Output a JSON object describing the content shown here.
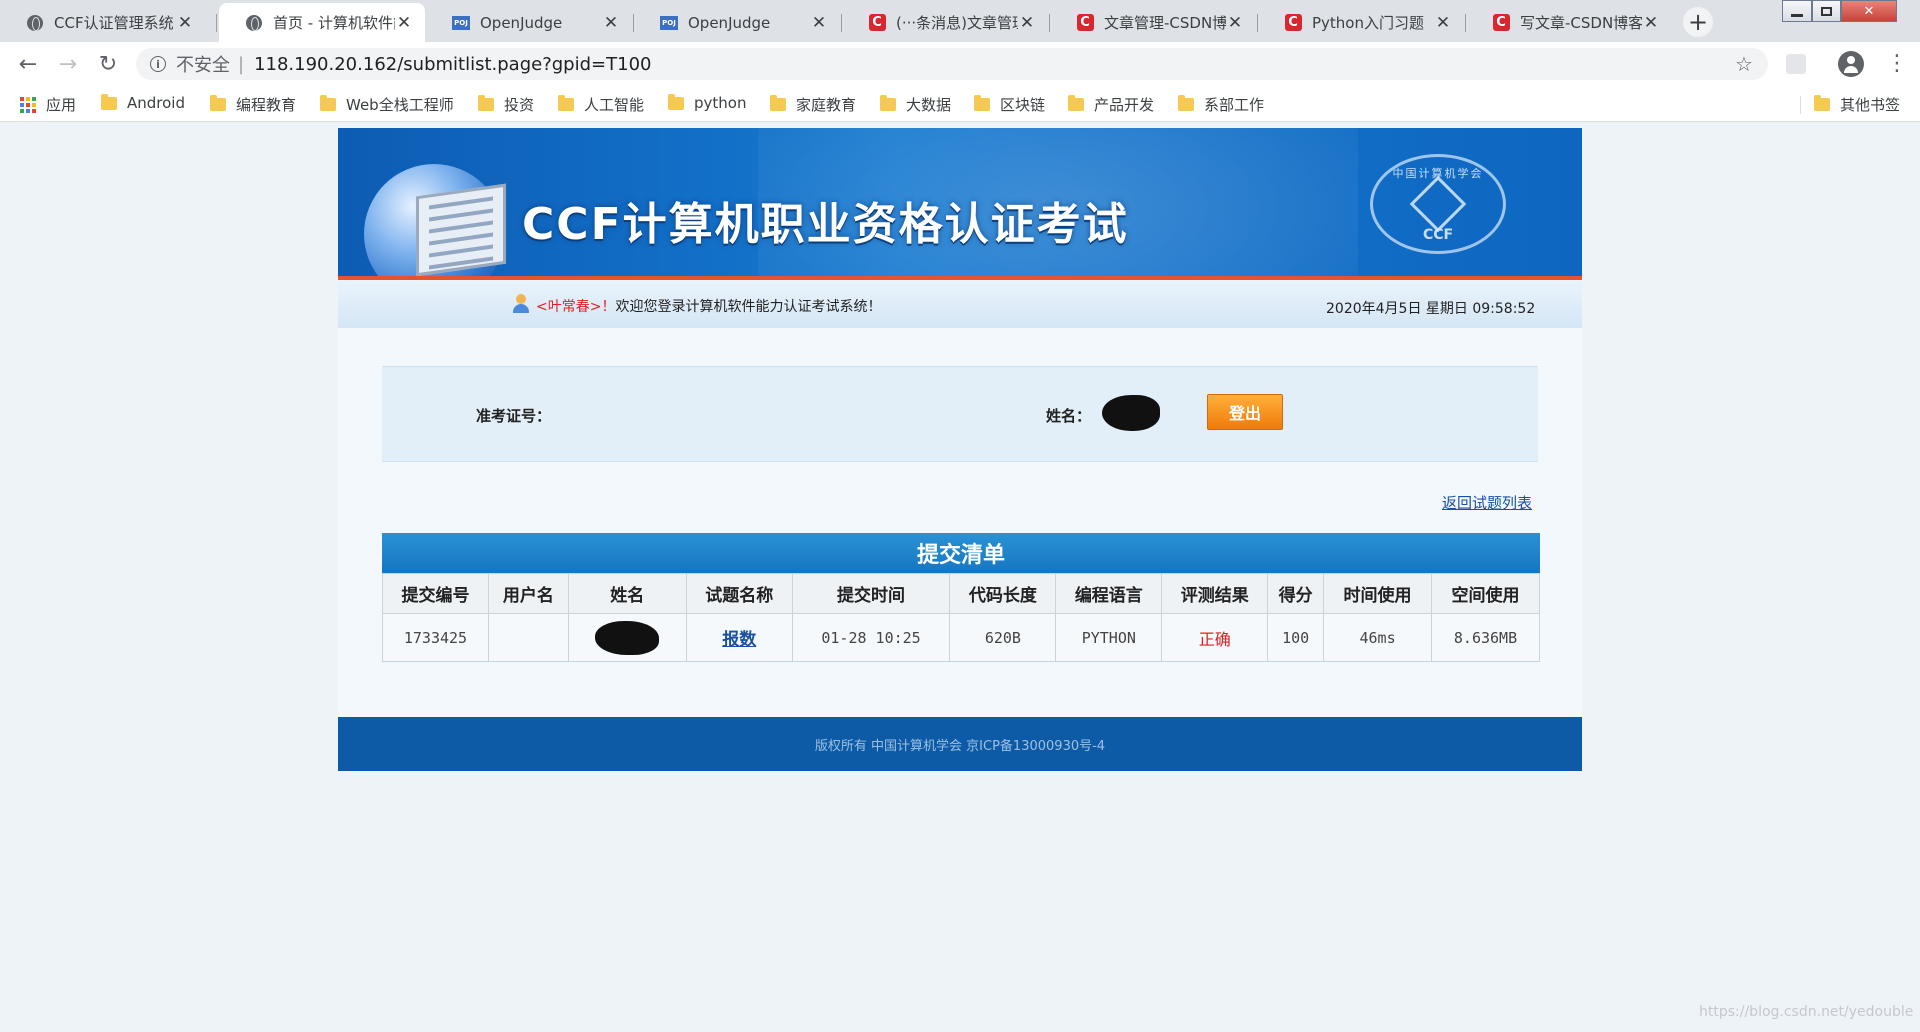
{
  "browser": {
    "tabs": [
      {
        "title": "CCF认证管理系统",
        "icon": "globe-icon",
        "active": false
      },
      {
        "title": "首页 - 计算机软件能",
        "icon": "globe-icon",
        "active": true
      },
      {
        "title": "OpenJudge",
        "icon": "poj-icon",
        "active": false
      },
      {
        "title": "OpenJudge",
        "icon": "poj-icon",
        "active": false
      },
      {
        "title": "(···条消息)文章管理",
        "icon": "csdn-icon",
        "active": false
      },
      {
        "title": "文章管理-CSDN博",
        "icon": "csdn-icon",
        "active": false
      },
      {
        "title": "Python入门习题（",
        "icon": "csdn-icon",
        "active": false
      },
      {
        "title": "写文章-CSDN博客",
        "icon": "csdn-icon",
        "active": false
      }
    ],
    "poj_icon_text": "POJ",
    "csdn_icon_text": "C",
    "new_tab": "+",
    "close_glyph": "✕",
    "back": "←",
    "forward": "→",
    "reload": "↻",
    "security_label": "不安全",
    "url": "118.190.20.162/submitlist.page?gpid=T100",
    "star": "☆",
    "menu": "⋮",
    "bookmarks": [
      {
        "label": "应用",
        "type": "apps"
      },
      {
        "label": "Android",
        "type": "folder"
      },
      {
        "label": "编程教育",
        "type": "folder"
      },
      {
        "label": "Web全栈工程师",
        "type": "folder"
      },
      {
        "label": "投资",
        "type": "folder"
      },
      {
        "label": "人工智能",
        "type": "folder"
      },
      {
        "label": "python",
        "type": "folder"
      },
      {
        "label": "家庭教育",
        "type": "folder"
      },
      {
        "label": "大数据",
        "type": "folder"
      },
      {
        "label": "区块链",
        "type": "folder"
      },
      {
        "label": "产品开发",
        "type": "folder"
      },
      {
        "label": "系部工作",
        "type": "folder"
      }
    ],
    "other_bookmarks": "其他书签"
  },
  "banner": {
    "title": "CCF计算机职业资格认证考试",
    "emblem_text": "中国计算机学会",
    "emblem_abbr": "CCF"
  },
  "welcome": {
    "username": "<叶常春>！",
    "message": "欢迎您登录计算机软件能力认证考试系统！",
    "datetime": "2020年4月5日 星期日 09:58:52"
  },
  "info": {
    "ticket_label": "准考证号：",
    "ticket_value": "",
    "name_label": "姓名：",
    "logout_label": "登出"
  },
  "back_link": "返回试题列表",
  "submissions": {
    "title": "提交清单",
    "headers": [
      "提交编号",
      "用户名",
      "姓名",
      "试题名称",
      "提交时间",
      "代码长度",
      "编程语言",
      "评测结果",
      "得分",
      "时间使用",
      "空间使用"
    ],
    "rows": [
      {
        "id": "1733425",
        "username": "",
        "problem": "报数",
        "time": "01-28 10:25",
        "length": "620B",
        "language": "PYTHON",
        "result": "正确",
        "score": "100",
        "time_used": "46ms",
        "memory_used": "8.636MB"
      }
    ]
  },
  "footer": "版权所有 中国计算机学会 京ICP备13000930号-4",
  "watermark": "https://blog.csdn.net/yedouble",
  "colors": {
    "banner_blue": "#1679d0",
    "accent_red": "#e02020",
    "logout_orange": "#f58a14",
    "footer_blue": "#0d5ba6",
    "link_blue": "#1a4fa3"
  }
}
